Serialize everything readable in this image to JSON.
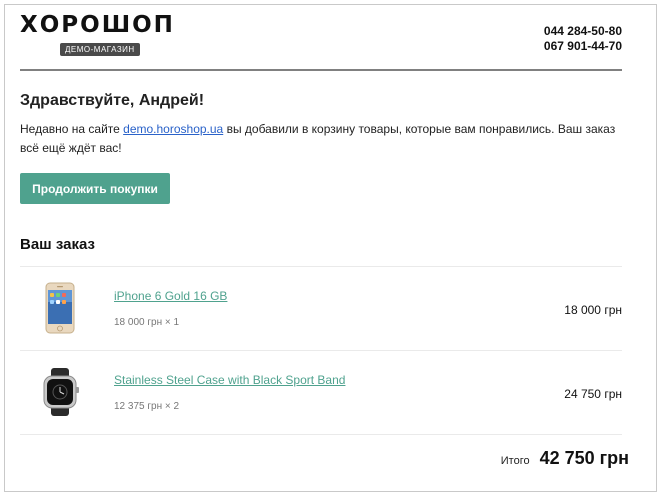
{
  "header": {
    "logo": "ХОРОШОП",
    "logo_sub": "ДЕМО-МАГАЗИН",
    "phone1": "044 284-50-80",
    "phone2": "067 901-44-70"
  },
  "greeting": "Здравствуйте, Андрей!",
  "message": {
    "before": "Недавно на сайте ",
    "link": "demo.horoshop.ua",
    "after": " вы добавили в корзину товары, которые вам понравились. Ваш заказ всё ещё ждёт вас!"
  },
  "cta_label": "Продолжить покупки",
  "order": {
    "title": "Ваш заказ",
    "items": [
      {
        "name": "iPhone 6 Gold 16 GB",
        "qty": "18 000 грн × 1",
        "price": "18 000 грн",
        "icon": "iphone-icon"
      },
      {
        "name": "Stainless Steel Case with Black Sport Band",
        "qty": "12 375 грн × 2",
        "price": "24 750 грн",
        "icon": "watch-icon"
      }
    ],
    "total_label": "Итого",
    "total_value": "42 750 грн"
  },
  "colors": {
    "accent": "#4fa28e",
    "link": "#2a62c9",
    "divider": "#808080"
  }
}
